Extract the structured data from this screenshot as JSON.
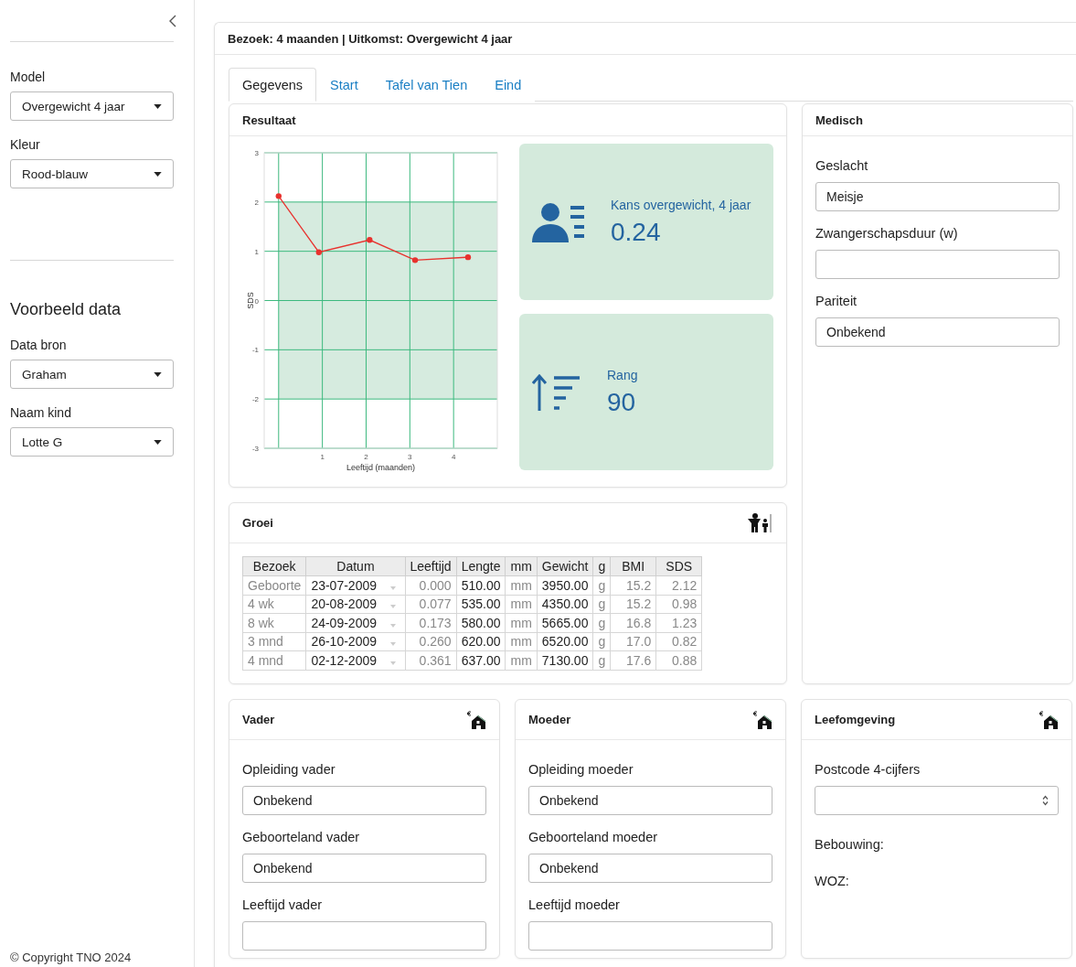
{
  "sidebar": {
    "fields": [
      {
        "label": "Model",
        "value": "Overgewicht 4 jaar"
      },
      {
        "label": "Kleur",
        "value": "Rood-blauw"
      }
    ],
    "example": {
      "title": "Voorbeeld data",
      "fields": [
        {
          "label": "Data bron",
          "value": "Graham"
        },
        {
          "label": "Naam kind",
          "value": "Lotte G"
        }
      ]
    },
    "copyright": "© Copyright TNO 2024"
  },
  "header": "Bezoek: 4 maanden | Uitkomst: Overgewicht 4 jaar",
  "tabs": [
    {
      "label": "Gegevens",
      "selected": true
    },
    {
      "label": "Start",
      "selected": false
    },
    {
      "label": "Tafel van Tien",
      "selected": false
    },
    {
      "label": "Eind",
      "selected": false
    }
  ],
  "result": {
    "title": "Resultaat",
    "chart_data": {
      "type": "line",
      "xlabel": "Leeftijd (maanden)",
      "ylabel": "SDS",
      "x": [
        0,
        0.92,
        2.08,
        3.12,
        4.33
      ],
      "xlim": [
        -0.33,
        5
      ],
      "ylim": [
        -3,
        3
      ],
      "xticks": [
        1,
        2,
        3,
        4
      ],
      "yticks": [
        -3,
        -2,
        -1,
        0,
        1,
        2,
        3
      ],
      "grid": true,
      "bands": [
        {
          "axis": "y",
          "from": -2,
          "to": 2,
          "color": "#d6ebdf"
        }
      ],
      "series": [
        {
          "color": "#e8322e",
          "marker": "circle",
          "values": [
            2.12,
            0.98,
            1.23,
            0.82,
            0.88
          ]
        }
      ]
    },
    "stats": [
      {
        "kind": "person",
        "label": "Kans overgewicht, 4 jaar",
        "value": "0.24"
      },
      {
        "kind": "rank",
        "label": "Rang",
        "value": "90"
      }
    ]
  },
  "medical": {
    "title": "Medisch",
    "fields": [
      {
        "kind": "text",
        "label": "Geslacht",
        "value": "Meisje"
      },
      {
        "kind": "text",
        "label": "Zwangerschapsduur (w)"
      },
      {
        "kind": "text",
        "label": "Pariteit",
        "value": "Onbekend"
      }
    ]
  },
  "growth": {
    "title": "Groei",
    "columns": [
      {
        "label": "Bezoek",
        "kind": "text",
        "muted": true
      },
      {
        "label": "Datum",
        "kind": "date",
        "muted": false
      },
      {
        "label": "Leeftijd",
        "kind": "number",
        "muted": true
      },
      {
        "label": "Lengte",
        "kind": "number",
        "muted": false
      },
      {
        "label": "mm",
        "kind": "unit",
        "muted": true
      },
      {
        "label": "Gewicht",
        "kind": "number",
        "muted": false
      },
      {
        "label": "g",
        "kind": "unit",
        "muted": true
      },
      {
        "label": "BMI",
        "kind": "number",
        "muted": true
      },
      {
        "label": "SDS",
        "kind": "number",
        "muted": true
      }
    ],
    "rows": [
      [
        "Geboorte",
        "23-07-2009",
        "0.000",
        "510.00",
        "mm",
        "3950.00",
        "g",
        "15.2",
        "2.12"
      ],
      [
        "4 wk",
        "20-08-2009",
        "0.077",
        "535.00",
        "mm",
        "4350.00",
        "g",
        "15.2",
        "0.98"
      ],
      [
        "8 wk",
        "24-09-2009",
        "0.173",
        "580.00",
        "mm",
        "5665.00",
        "g",
        "16.8",
        "1.23"
      ],
      [
        "3 mnd",
        "26-10-2009",
        "0.260",
        "620.00",
        "mm",
        "6520.00",
        "g",
        "17.0",
        "0.82"
      ],
      [
        "4 mnd",
        "02-12-2009",
        "0.361",
        "637.00",
        "mm",
        "7130.00",
        "g",
        "17.6",
        "0.88"
      ]
    ]
  },
  "cards": [
    {
      "title": "Vader",
      "fields": [
        {
          "kind": "text",
          "label": "Opleiding vader",
          "value": "Onbekend"
        },
        {
          "kind": "text",
          "label": "Geboorteland vader",
          "value": "Onbekend"
        },
        {
          "kind": "text",
          "label": "Leeftijd vader"
        }
      ]
    },
    {
      "title": "Moeder",
      "fields": [
        {
          "kind": "text",
          "label": "Opleiding moeder",
          "value": "Onbekend"
        },
        {
          "kind": "text",
          "label": "Geboorteland moeder",
          "value": "Onbekend"
        },
        {
          "kind": "text",
          "label": "Leeftijd moeder"
        }
      ]
    },
    {
      "title": "Leefomgeving",
      "fields": [
        {
          "kind": "number",
          "label": "Postcode 4-cijfers"
        },
        {
          "kind": "fact",
          "label": "Bebouwing:"
        },
        {
          "kind": "fact",
          "label": "WOZ:"
        }
      ]
    }
  ]
}
